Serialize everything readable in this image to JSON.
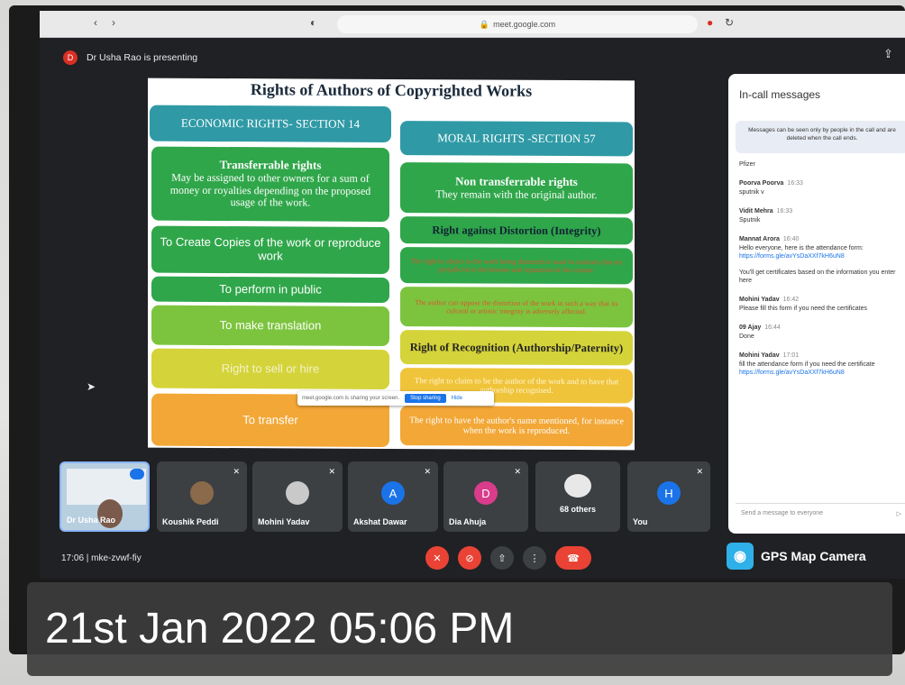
{
  "browser": {
    "url": "meet.google.com"
  },
  "presenter": {
    "initial": "D",
    "text": "Dr Usha Rao is presenting"
  },
  "slide": {
    "title": "Rights of Authors of Copyrighted Works",
    "economic_header": "ECONOMIC RIGHTS- SECTION 14",
    "moral_header": "MORAL RIGHTS -SECTION 57",
    "transferable_title": "Transferrable rights",
    "transferable_body": "May be assigned to other owners for a sum of money or royalties depending on the proposed usage of the work.",
    "copies": "To Create Copies of the work or reproduce work",
    "perform": "To perform in public",
    "translation": "To make translation",
    "sell": "Right to sell or hire",
    "transfer": "To transfer",
    "nontransfer_title": "Non transferrable rights",
    "nontransfer_body": "They remain with the original author.",
    "distortion_title": "Right against Distortion (Integrity)",
    "distortion_body1": "The right to object to the work being distorted or used in contexts that are prejudicial to the honour and reputation of the creator.",
    "distortion_body2": "The author can oppose the distortion of the work in such a way that its cultural or artistic integrity is adversely affected.",
    "recognition_title": "Right of Recognition (Authorship/Paternity)",
    "recognition_body1": "The right to claim to be the author of the work and to have that authorship recognised.",
    "recognition_body2": "The right to have the author's name mentioned, for instance when the work is reproduced."
  },
  "share_notice": {
    "text": "meet.google.com is sharing your screen.",
    "stop": "Stop sharing",
    "hide": "Hide"
  },
  "chat": {
    "title": "In-call messages",
    "note": "Messages can be seen only by people in the call and are deleted when the call ends.",
    "messages": [
      {
        "who": "",
        "time": "",
        "text": "Pfizer"
      },
      {
        "who": "Poorva Poorva",
        "time": "16:33",
        "text": "sputnik v"
      },
      {
        "who": "Vidit Mehra",
        "time": "16:33",
        "text": "Sputnik"
      },
      {
        "who": "Mannat Arora",
        "time": "16:40",
        "text": "Hello everyone, here is the attendance form:",
        "link": "https://forms.gle/avYsDaXXf7kH6uN8",
        "extra": "You'll get certificates based on the information you enter here"
      },
      {
        "who": "Mohini Yadav",
        "time": "16:42",
        "text": "Please fill this form if you need the certificates"
      },
      {
        "who": "09 Ajay",
        "time": "16:44",
        "text": "Done"
      },
      {
        "who": "Mohini Yadav",
        "time": "17:01",
        "text": "fill the attendance form if you need the certificate",
        "link": "https://forms.gle/avYsDaXXf7kH6uN8"
      }
    ],
    "input_placeholder": "Send a message to everyone"
  },
  "tiles": [
    {
      "name": "Dr Usha Rao"
    },
    {
      "name": "Koushik Peddi"
    },
    {
      "name": "Mohini Yadav"
    },
    {
      "name": "Akshat Dawar",
      "initial": "A"
    },
    {
      "name": "Dia Ahuja",
      "initial": "D"
    },
    {
      "name": "68 others"
    },
    {
      "name": "You",
      "initial": "H"
    }
  ],
  "meeting": {
    "info": "17:06  |  mke-zvwf-fiy"
  },
  "gps": {
    "label": "GPS Map Camera"
  },
  "timestamp": "21st Jan 2022 05:06 PM",
  "colors": {
    "teal": "#2f9aa6",
    "green": "#2fa64a",
    "orange": "#f2a736",
    "end_call": "#ea4335"
  }
}
